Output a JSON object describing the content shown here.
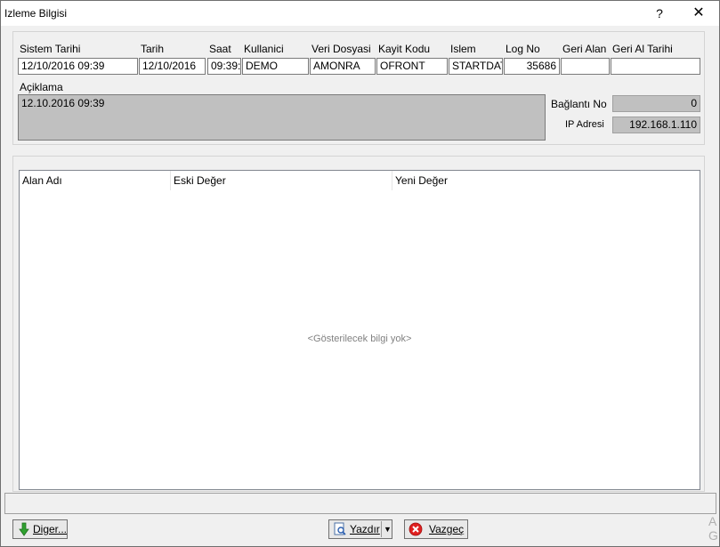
{
  "window": {
    "title": "Izleme Bilgisi",
    "help": "?",
    "close": "✕"
  },
  "header": {
    "labels": {
      "sistem_tarihi": "Sistem Tarihi",
      "tarih": "Tarih",
      "saat": "Saat",
      "kullanici": "Kullanici",
      "veri_dosyasi": "Veri Dosyasi",
      "kayit_kodu": "Kayit Kodu",
      "islem": "Islem",
      "log_no": "Log No",
      "geri_alan": "Geri Alan",
      "geri_al_tarihi": "Geri Al Tarihi",
      "aciklama": "Açiklama",
      "baglanti_no": "Bağlantı No",
      "ip_adresi": "IP Adresi"
    },
    "values": {
      "sistem_tarihi": "12/10/2016 09:39",
      "tarih": "12/10/2016",
      "saat": "09:39:",
      "kullanici": "DEMO",
      "veri_dosyasi": "AMONRA",
      "kayit_kodu": "OFRONT",
      "islem": "STARTDAT",
      "log_no": "35686",
      "geri_alan": "",
      "geri_al_tarihi": "",
      "aciklama": "12.10.2016 09:39",
      "baglanti_no": "0",
      "ip_adresi": "192.168.1.110"
    }
  },
  "grid": {
    "columns": [
      "Alan Adı",
      "Eski Değer",
      "Yeni Değer"
    ],
    "empty_text": "<Gösterilecek bilgi yok>"
  },
  "buttons": {
    "diger": "Diger...",
    "yazdir": "Yazdır",
    "vazgec": "Vazgeç"
  },
  "corner_text": "A G"
}
